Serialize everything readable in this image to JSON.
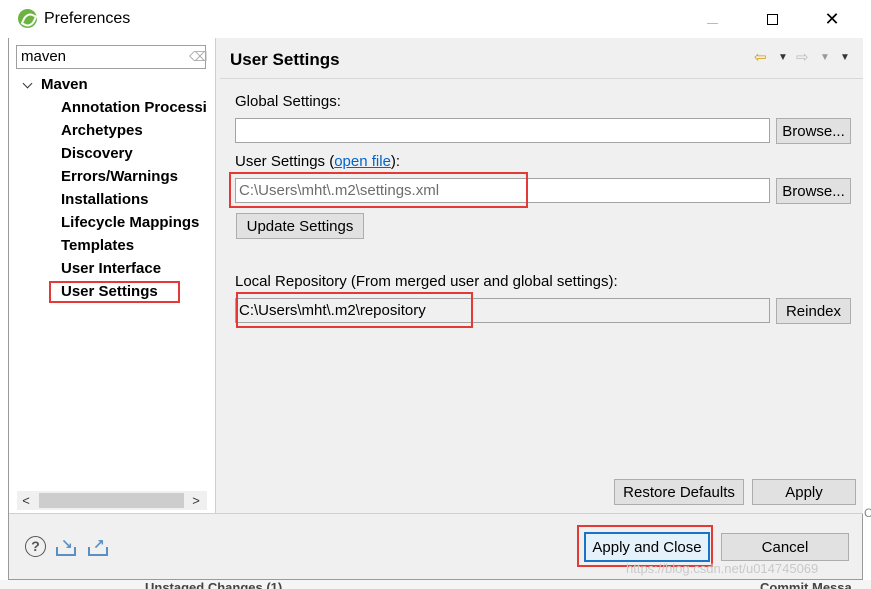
{
  "window": {
    "title": "Preferences",
    "controls": {
      "minimize": "",
      "maximize": "",
      "close": "✕"
    }
  },
  "sidebar": {
    "filter_value": "maven",
    "items": [
      {
        "label": "Maven"
      },
      {
        "label": "Annotation Processing"
      },
      {
        "label": "Archetypes"
      },
      {
        "label": "Discovery"
      },
      {
        "label": "Errors/Warnings"
      },
      {
        "label": "Installations"
      },
      {
        "label": "Lifecycle Mappings"
      },
      {
        "label": "Templates"
      },
      {
        "label": "User Interface"
      },
      {
        "label": "User Settings"
      }
    ],
    "selected": "User Settings"
  },
  "page": {
    "title": "User Settings",
    "global_settings_label": "Global Settings:",
    "global_settings_value": "",
    "global_browse": "Browse...",
    "user_settings_label_prefix": "User Settings (",
    "user_settings_link": "open file",
    "user_settings_label_suffix": "):",
    "user_settings_value": "C:\\Users\\mht\\.m2\\settings.xml",
    "user_browse": "Browse...",
    "update_settings": "Update Settings",
    "local_repo_label": "Local Repository (From merged user and global settings):",
    "local_repo_value": "C:\\Users\\mht\\.m2\\repository",
    "reindex": "Reindex",
    "restore_defaults": "Restore Defaults",
    "apply": "Apply"
  },
  "footer": {
    "apply_and_close": "Apply and Close",
    "cancel": "Cancel"
  },
  "background": {
    "left_text": "Unstaged Changes (1)",
    "right_text": "Commit Messa",
    "watermark": "https://blog.csdn.net/u014745069",
    "side_fragment": "Co"
  },
  "colors": {
    "highlight": "#e53935",
    "link": "#0066cc",
    "accent_icon": "#d79a00"
  }
}
